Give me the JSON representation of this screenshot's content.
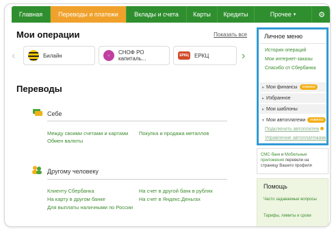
{
  "nav": {
    "items": [
      {
        "label": "Главная",
        "active": false
      },
      {
        "label": "Переводы и платежи",
        "active": true
      },
      {
        "label": "Вклады и счета",
        "active": false
      },
      {
        "label": "Карты",
        "active": false
      },
      {
        "label": "Кредиты",
        "active": false
      },
      {
        "label": "Прочее",
        "active": false
      }
    ],
    "more_caret": "▾",
    "gear_icon": "⚙"
  },
  "operations": {
    "title": "Мои операции",
    "show_all": "Показать все",
    "prev_arrow": "‹",
    "next_arrow": "›",
    "cards": [
      {
        "label": "Билайн",
        "logo": "beeline-logo"
      },
      {
        "label": "СНОФ РО капиталь...",
        "logo": "snof-logo"
      },
      {
        "label": "ЕРКЦ",
        "logo": "erkc-logo",
        "logo_text": "ЕРКЦ"
      }
    ]
  },
  "transfers": {
    "title": "Переводы",
    "self": {
      "title": "Себе",
      "links": [
        "Между своими счетами и картами",
        "Покупка и продажа металлов",
        "Обмен валюты"
      ]
    },
    "other": {
      "title": "Другому человеку",
      "links": [
        "Клиенту Сбербанка",
        "На счет в другой банк в рублях",
        "На карту в другом банке",
        "На счет в Яндекс.Деньгах",
        "Для выплаты наличными по России"
      ]
    }
  },
  "personal_menu": {
    "title": "Личное меню",
    "links": [
      "История операций",
      "Мои интернет-заказы",
      "Спасибо от Сбербанка"
    ],
    "rows": [
      {
        "label": "Мои финансы",
        "badge": "новинка"
      },
      {
        "label": "Избранное",
        "badge": ""
      },
      {
        "label": "Мои шаблоны",
        "badge": ""
      },
      {
        "label": "Мои автоплатежи",
        "badge": "новинка"
      }
    ],
    "sub_links": [
      "Подключить автоплатеж",
      "Управление автоплатежами"
    ]
  },
  "sms_note": {
    "part1": "СМС-банк",
    "part2": " и ",
    "part3": "Мобильные приложения",
    "part4": " перевели на страницу Вашего профиля"
  },
  "help": {
    "title": "Помощь",
    "links": [
      "Часто задаваемые вопросы",
      "Тарифы, лимиты и сроки"
    ]
  },
  "colors": {
    "nav_green": "#2f8f2f",
    "nav_active": "#f0a12b",
    "link_green": "#3c8c2e",
    "menu_border": "#2f9ad6",
    "badge": "#f2b017"
  }
}
